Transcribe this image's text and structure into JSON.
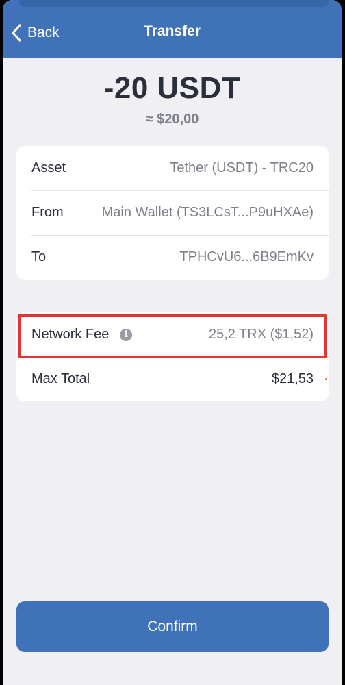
{
  "header": {
    "back_label": "Back",
    "title": "Transfer"
  },
  "summary": {
    "amount": "-20 USDT",
    "fiat": "≈ $20,00"
  },
  "details": [
    {
      "label": "Asset",
      "value": "Tether (USDT) - TRC20"
    },
    {
      "label": "From",
      "value": "Main Wallet (TS3LCsT...P9uHXAe)"
    },
    {
      "label": "To",
      "value": "TPHCvU6...6B9EmKv"
    }
  ],
  "fees": {
    "network_fee_label": "Network Fee",
    "network_fee_value": "25,2 TRX ($1,52)",
    "max_total_label": "Max Total",
    "max_total_value": "$21,53"
  },
  "info_icon_glyph": "i",
  "confirm_label": "Confirm",
  "colors": {
    "accent": "#3f72b8",
    "highlight": "#e3342f",
    "background": "#efeff4"
  }
}
